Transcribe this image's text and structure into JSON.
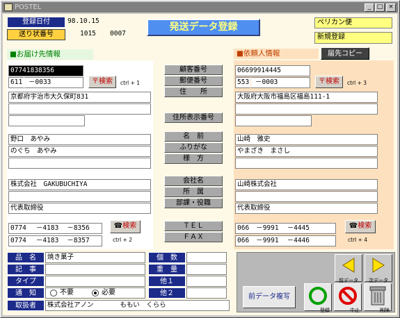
{
  "window": {
    "title": "POSTEL",
    "min": "_",
    "max": "□",
    "close": "×"
  },
  "header": {
    "reg_date_label": "登録日付",
    "reg_date": "98.10.15",
    "slip_label": "送り状番号",
    "slip_no1": "1015",
    "slip_no2": "0007",
    "main_title": "発送データ登録",
    "carrier": "ペリカン便",
    "mode": "新規登録"
  },
  "dest": {
    "section": "■お届け先情報",
    "phone": "07741838356",
    "zip1": "611",
    "zip2": "0033",
    "zip_btn": "〒検索",
    "zip_hint": "ctrl + 1",
    "addr1": "京都府宇治市大久保町831",
    "addr2": "",
    "addr3": "",
    "name": "野口　あやみ",
    "kana": "のぐち　あやみ",
    "title_field": "",
    "company": "株式会社　GAKUBUCHIYA",
    "dept": "",
    "position": "代表取締役",
    "tel": [
      "0774",
      "4183",
      "8356"
    ],
    "fax": [
      "0774",
      "4183",
      "8357"
    ],
    "tel_btn": "検索",
    "tel_hint": "ctrl + 2"
  },
  "center": {
    "customer_no": "顧客番号",
    "zip": "郵便番号",
    "address": "住　　所",
    "addr_display": "住所表示番号",
    "name": "名　前",
    "kana": "ふりがな",
    "honorific": "様　方",
    "company": "会社名",
    "dept": "所　属",
    "position": "部課・役職",
    "tel": "ＴＥＬ",
    "fax": "ＦＡＸ"
  },
  "sender": {
    "section": "■依頼人情報",
    "copy_btn": "届先コピー",
    "phone": "06699914445",
    "zip1": "553",
    "zip2": "0003",
    "zip_btn": "〒検索",
    "zip_hint": "ctrl + 3",
    "addr1": "大阪府大阪市福島区福島111-1",
    "addr2": "",
    "addr3": "",
    "name": "山崎　雅史",
    "kana": "やまざき　まさし",
    "title_field": "",
    "company": "山崎株式会社",
    "dept": "",
    "position": "代表取締役",
    "tel": [
      "066",
      "9991",
      "4445"
    ],
    "fax": [
      "066",
      "9991",
      "4446"
    ],
    "tel_btn": "検索",
    "tel_hint": "ctrl + 4"
  },
  "bottom": {
    "item_label": "品　名",
    "item": "焼き菓子",
    "note_label": "記　事",
    "note": "",
    "type_label": "タイプ",
    "type": "",
    "notify_label": "通　知",
    "notify_no": "不要",
    "notify_yes": "必要",
    "handler_label": "取扱者",
    "handler": "株式会社アノン　　　　ももい　くらら",
    "qty_label": "個　数",
    "qty": "",
    "weight_label": "重　量",
    "weight": "",
    "other1_label": "他１",
    "other1": "",
    "other2_label": "他２",
    "other2": ""
  },
  "actions": {
    "prev_data": "前データ",
    "next_data": "次データ",
    "copy_prev": "前データ複写",
    "register": "登録",
    "abort": "中止",
    "delete": "削除"
  },
  "colors": {
    "label_bg": "#1c2a8a",
    "client_bg": "#fdf9e6",
    "yellow": "#ffff80",
    "peach": "#fde1bf",
    "green": "#00a000",
    "red": "#e00000"
  }
}
